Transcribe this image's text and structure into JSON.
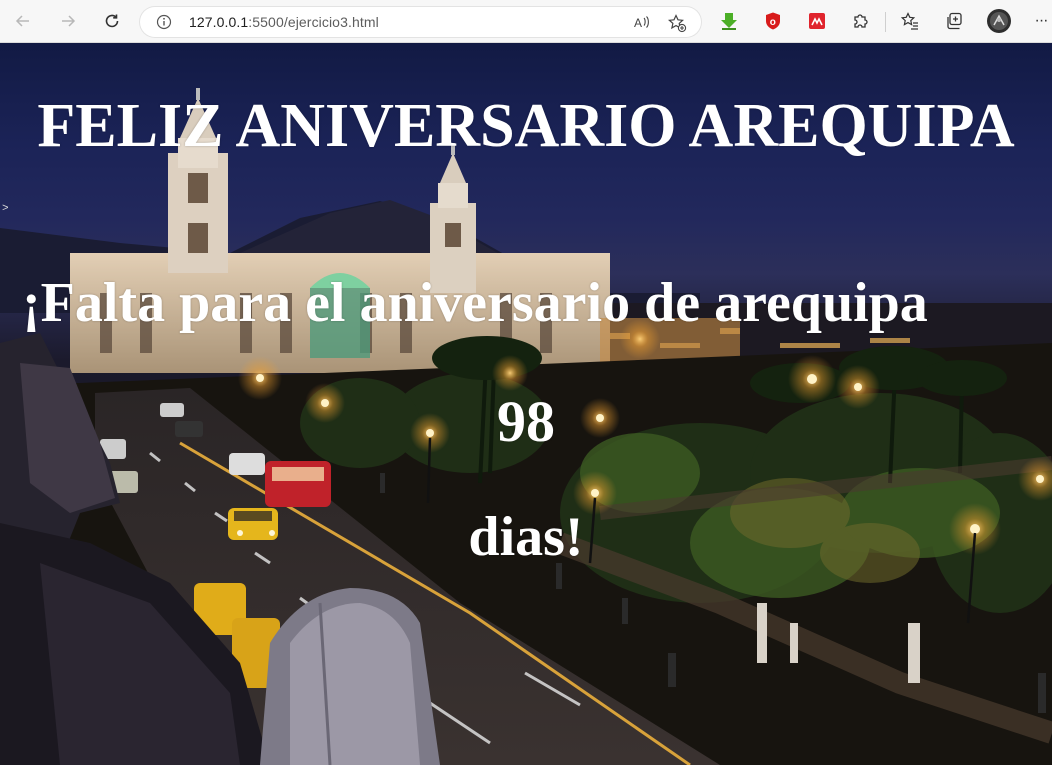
{
  "browser": {
    "url_host": "127.0.0.1",
    "url_rest": ":5500/ejercicio3.html",
    "more_label": "···"
  },
  "icons": {
    "back": "arrow-left-icon",
    "forward": "arrow-right-icon",
    "refresh": "refresh-icon",
    "site_info": "info-icon",
    "read_aloud": "read-aloud-icon",
    "add_favorite": "star-plus-icon",
    "ext_download": "green-download-extension-icon",
    "ext_ublock": "red-shield-extension-icon",
    "ext_red": "red-square-extension-icon",
    "extensions": "puzzle-icon",
    "favorites": "star-list-icon",
    "collections": "collections-icon",
    "profile": "avatar"
  },
  "colors": {
    "toolbar_bg": "#f7f7f7",
    "heading_color": "#ffffff",
    "sky_top": "#121a44"
  },
  "page": {
    "title": "FELIZ ANIVERSARIO AREQUIPA",
    "subtitle": "¡Falta para el aniversario de arequipa",
    "days_count": "98",
    "days_label": "dias!",
    "stray_marker": ">"
  }
}
